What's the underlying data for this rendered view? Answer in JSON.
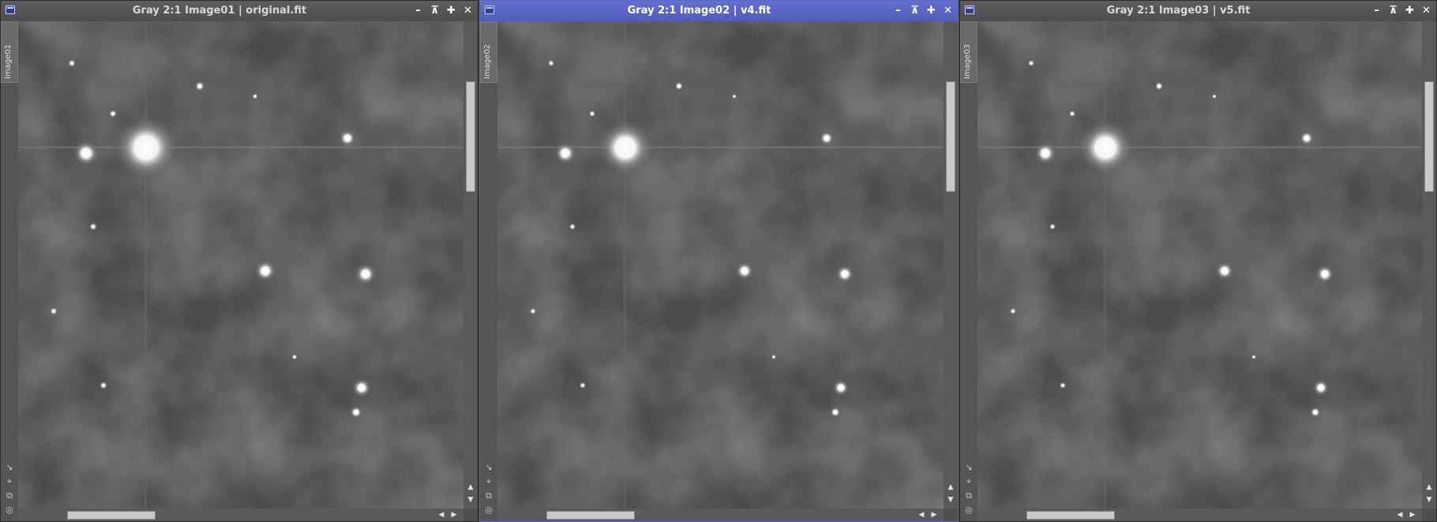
{
  "windows": [
    {
      "title": "Gray 2:1 Image01 | original.fit",
      "side_tab": "Image01",
      "active": false,
      "vertical_scroll_fraction": 0.06,
      "horizontal_scroll_fraction": 0.1
    },
    {
      "title": "Gray 2:1 Image02 | v4.fit",
      "side_tab": "Image02",
      "active": true,
      "vertical_scroll_fraction": 0.06,
      "horizontal_scroll_fraction": 0.1
    },
    {
      "title": "Gray 2:1 Image03 | v5.fit",
      "side_tab": "Image03",
      "active": false,
      "vertical_scroll_fraction": 0.06,
      "horizontal_scroll_fraction": 0.1
    }
  ],
  "titlebar_buttons": [
    "minimize-icon",
    "shade-icon",
    "maximize-icon",
    "close-icon"
  ],
  "side_tools": [
    "zoom-fit-icon",
    "preview-icon",
    "clone-icon",
    "mask-icon"
  ],
  "colors": {
    "active_titlebar": "#5a66c4",
    "inactive_titlebar": "#555555",
    "background": "#3b3b3b"
  }
}
